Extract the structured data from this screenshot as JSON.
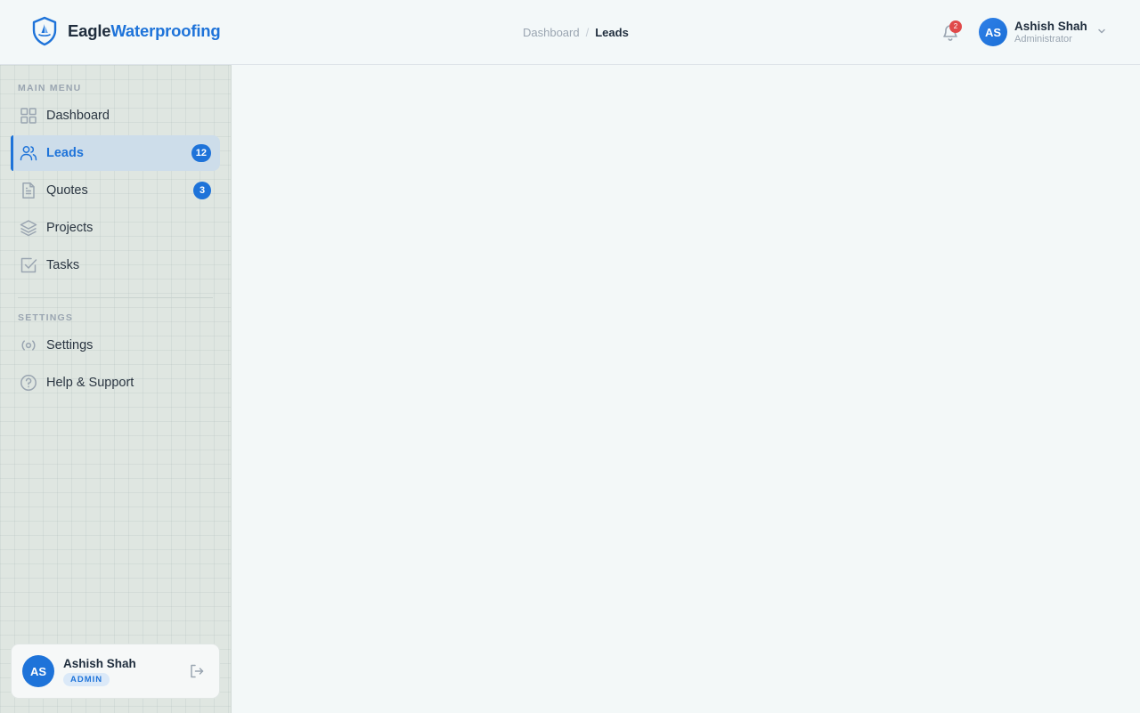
{
  "brand": {
    "part1": "Eagle",
    "part2": "Waterproofing"
  },
  "breadcrumb": {
    "parent": "Dashboard",
    "separator": "/",
    "current": "Leads"
  },
  "notifications": {
    "count": "2"
  },
  "user": {
    "initials": "AS",
    "name": "Ashish Shah",
    "role": "Administrator",
    "badge": "ADMIN"
  },
  "sidebar": {
    "main_menu_label": "MAIN MENU",
    "items": [
      {
        "label": "Dashboard",
        "icon": "grid-icon"
      },
      {
        "label": "Leads",
        "icon": "users-icon",
        "badge": "12",
        "active": true
      },
      {
        "label": "Quotes",
        "icon": "file-text-icon",
        "badge": "3"
      },
      {
        "label": "Projects",
        "icon": "layers-icon"
      },
      {
        "label": "Tasks",
        "icon": "check-square-icon"
      }
    ],
    "settings_label": "SETTINGS",
    "settings_items": [
      {
        "label": "Settings",
        "icon": "settings-icon"
      },
      {
        "label": "Help & Support",
        "icon": "help-circle-icon"
      }
    ]
  },
  "colors": {
    "accent": "#1e73d9",
    "badge_red": "#e04a4a",
    "sidebar_bg": "#dfe6e1",
    "main_bg": "#f3f8f8"
  }
}
